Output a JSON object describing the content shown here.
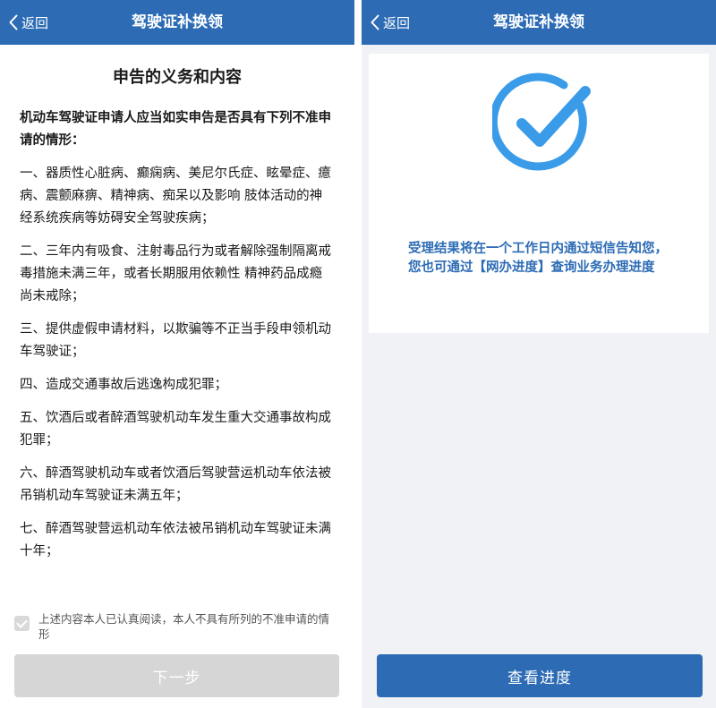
{
  "left": {
    "navbar": {
      "back_label": "返回",
      "title": "驾驶证补换领"
    },
    "declaration": {
      "title": "申告的义务和内容",
      "intro": "机动车驾驶证申请人应当如实申告是否具有下列不准申请的情形：",
      "items": [
        "一、器质性心脏病、癫痫病、美尼尔氏症、眩晕症、癔病、震颤麻痹、精神病、痴呆以及影响 肢体活动的神经系统疾病等妨碍安全驾驶疾病；",
        "二、三年内有吸食、注射毒品行为或者解除强制隔离戒毒措施未满三年，或者长期服用依赖性 精神药品成瘾尚未戒除；",
        "三、提供虚假申请材料，以欺骗等不正当手段申领机动车驾驶证；",
        "四、造成交通事故后逃逸构成犯罪；",
        "五、饮酒后或者醉酒驾驶机动车发生重大交通事故构成犯罪；",
        "六、醉酒驾驶机动车或者饮酒后驾驶营运机动车依法被吊销机动车驾驶证未满五年；",
        "七、醉酒驾驶营运机动车依法被吊销机动车驾驶证未满十年；"
      ]
    },
    "agree_text": "上述内容本人已认真阅读，本人不具有所列的不准申请的情形",
    "agree_checked": true,
    "next_button": "下一步"
  },
  "right": {
    "navbar": {
      "back_label": "返回",
      "title": "驾驶证补换领"
    },
    "result_text": "受理结果将在一个工作日内通过短信告知您，您也可通过【网办进度】查询业务办理进度",
    "progress_button": "查看进度"
  },
  "colors": {
    "navbar": "#2d6cb5",
    "success_icon": "#3a9be8",
    "disabled_button": "#d6d6d6",
    "primary_button": "#2d6cb5"
  }
}
